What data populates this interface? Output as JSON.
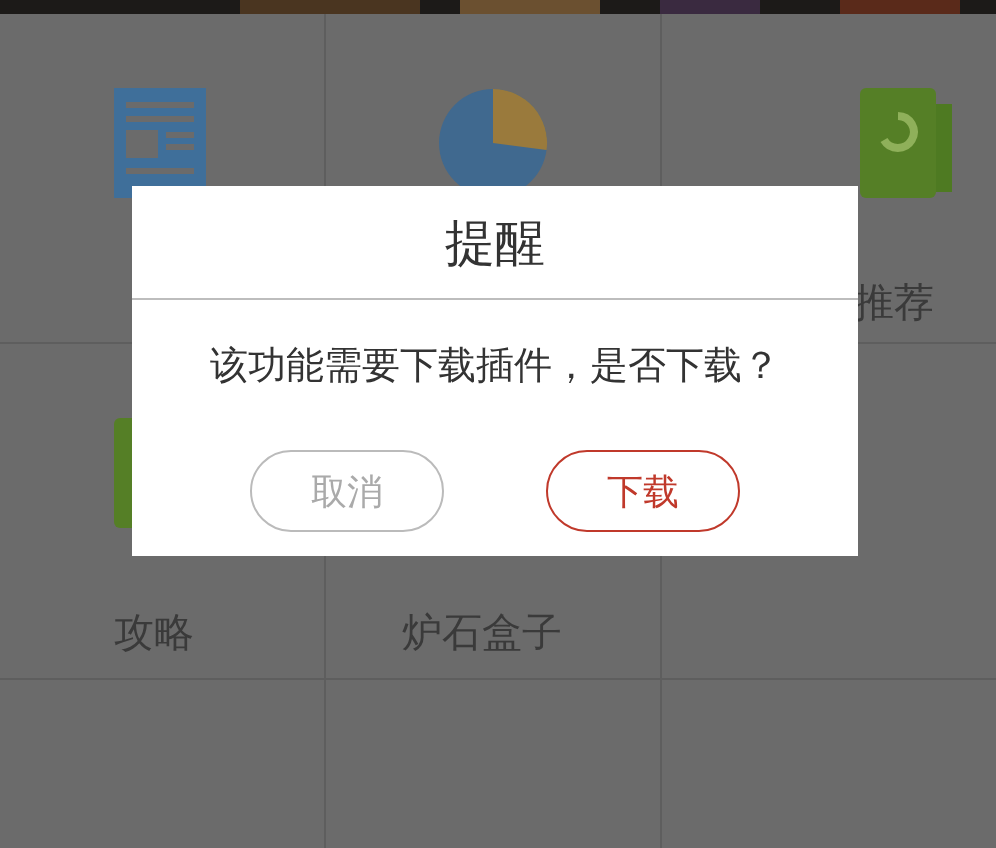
{
  "grid": [
    {
      "kind": "newspaper"
    },
    {
      "kind": "pie"
    },
    {
      "kind": "book",
      "label": "推荐"
    },
    {
      "kind": "book",
      "label": "攻略"
    },
    {
      "kind": "text",
      "label": "炉石盒子"
    },
    {
      "kind": "empty"
    },
    {
      "kind": "empty"
    },
    {
      "kind": "empty"
    },
    {
      "kind": "empty"
    }
  ],
  "dialog": {
    "title": "提醒",
    "message": "该功能需要下载插件，是否下载？",
    "buttons": [
      {
        "label": "取消",
        "kind": "cancel"
      },
      {
        "label": "下载",
        "kind": "confirm"
      }
    ]
  }
}
